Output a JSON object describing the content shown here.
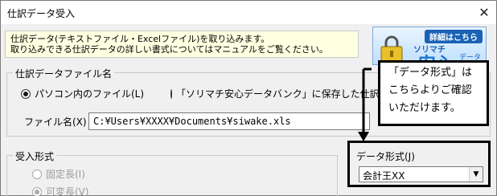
{
  "window": {
    "title": "仕訳データ受入",
    "close_glyph": "✕"
  },
  "info": {
    "line1": "仕訳データ(テキストファイル・Excelファイル)を取り込みます。",
    "line2": "取り込みできる仕訳データの詳しい書式についてはマニュアルをご覧ください。"
  },
  "banner": {
    "tag": "詳細はこちら",
    "brand": "ソリマチ",
    "logo": "安心",
    "sub": "データ"
  },
  "file_group": {
    "legend": "仕訳データファイル名",
    "options": [
      {
        "label": "パソコン内のファイル(L)",
        "checked": true
      },
      {
        "label": "「ソリマチ安心データバンク」に保存した仕訳デ",
        "checked": false
      }
    ],
    "file_label": "ファイル名(X)",
    "file_value": "C:¥Users¥XXXX¥Documents¥siwake.xls"
  },
  "format_group": {
    "legend": "受入形式",
    "options": [
      {
        "label": "固定長(I)",
        "checked": false
      },
      {
        "label": "可変長(V)",
        "checked": true
      }
    ]
  },
  "callout": {
    "line1": "「データ形式」は",
    "line2": "こちらよりご確認",
    "line3": "いただけます。"
  },
  "data_format": {
    "label": "データ形式(J)",
    "selected": "会計王XX",
    "dropdown_glyph": "▼"
  }
}
